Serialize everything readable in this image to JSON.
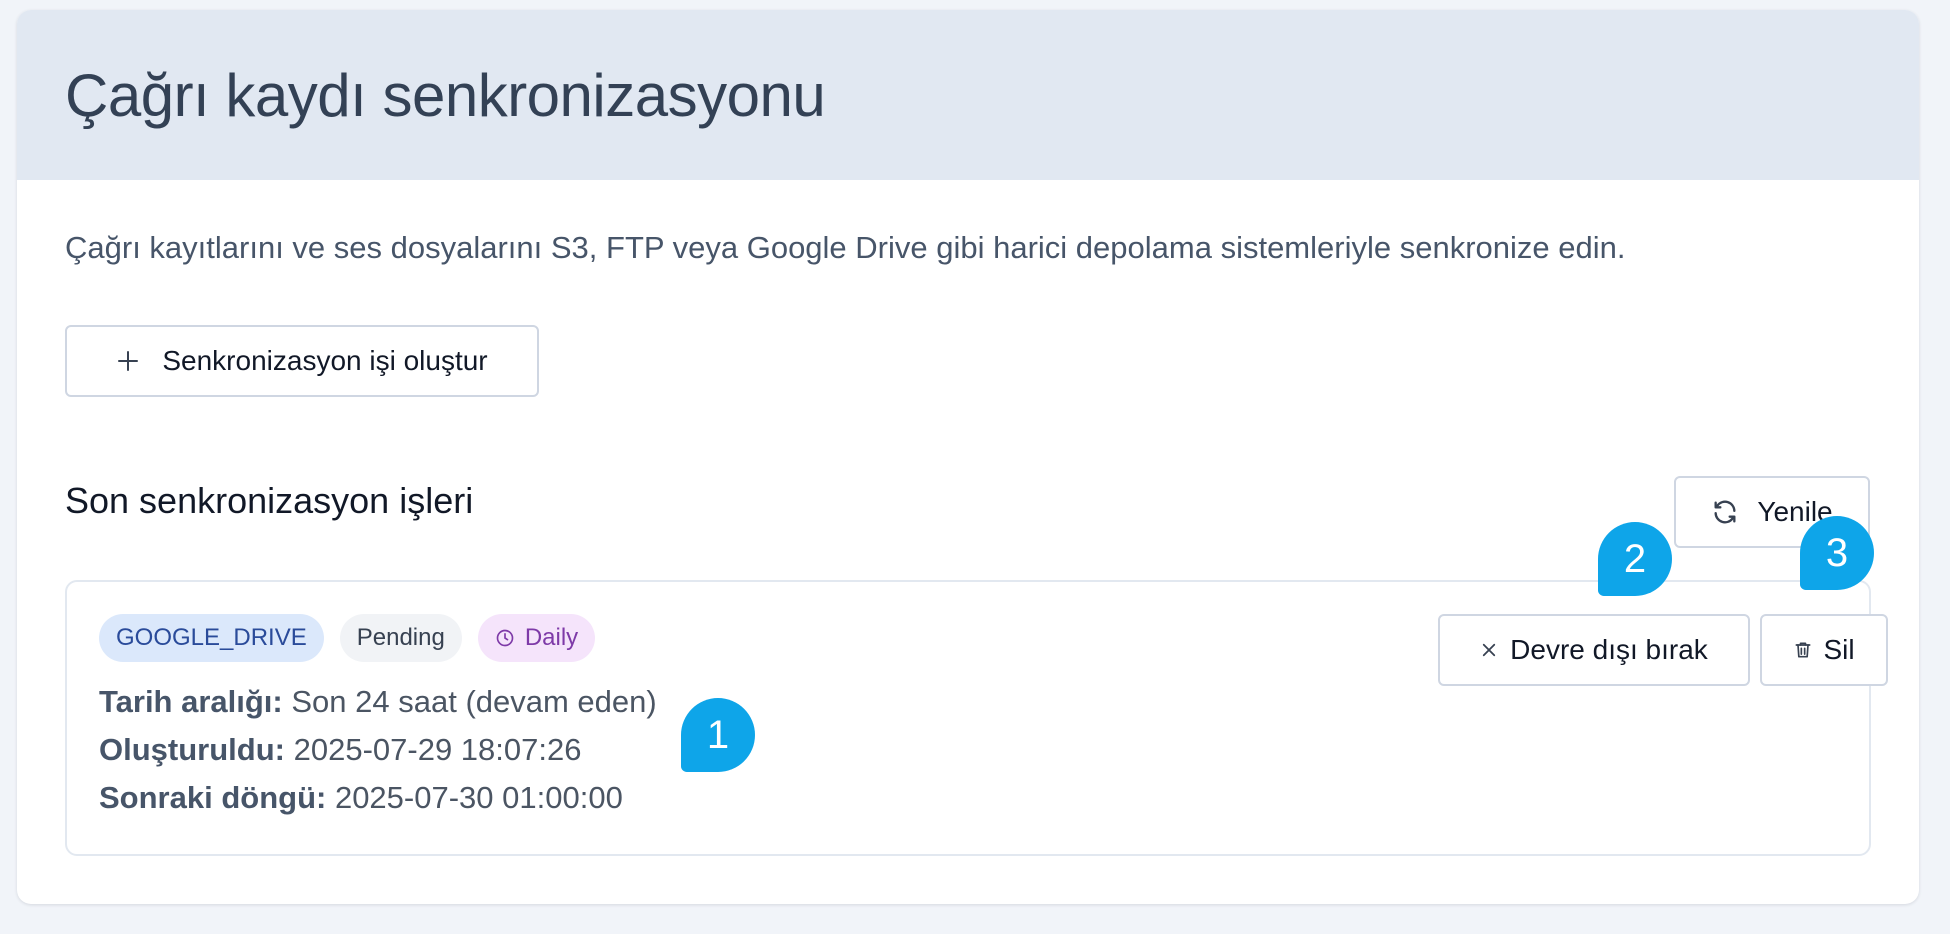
{
  "header": {
    "title": "Çağrı kaydı senkronizasyonu"
  },
  "main": {
    "description": "Çağrı kayıtlarını ve ses dosyalarını S3, FTP veya Google Drive gibi harici depolama sistemleriyle senkronize edin.",
    "create_button": {
      "label": "Senkronizasyon işi oluştur",
      "icon": "plus-icon"
    },
    "recent_jobs": {
      "title": "Son senkronizasyon işleri",
      "refresh_button": {
        "label": "Yenile",
        "icon": "refresh-icon"
      },
      "jobs": [
        {
          "badges": {
            "type": "GOOGLE_DRIVE",
            "status": "Pending",
            "schedule": "Daily"
          },
          "date_range_label": "Tarih aralığı:",
          "date_range_value": "Son 24 saat (devam eden)",
          "created_label": "Oluşturuldu:",
          "created_value": "2025-07-29 18:07:26",
          "next_cycle_label": "Sonraki döngü:",
          "next_cycle_value": "2025-07-30 01:00:00",
          "disable_button": {
            "label": "Devre dışı bırak",
            "icon": "close-icon"
          },
          "delete_button": {
            "label": "Sil",
            "icon": "trash-icon"
          }
        }
      ]
    }
  },
  "callouts": [
    "1",
    "2",
    "3"
  ],
  "colors": {
    "header_bg": "#e1e8f2",
    "callout": "#0ea5e9",
    "badge_type_bg": "#dbe8fb",
    "badge_schedule_bg": "#f5e4fb"
  }
}
